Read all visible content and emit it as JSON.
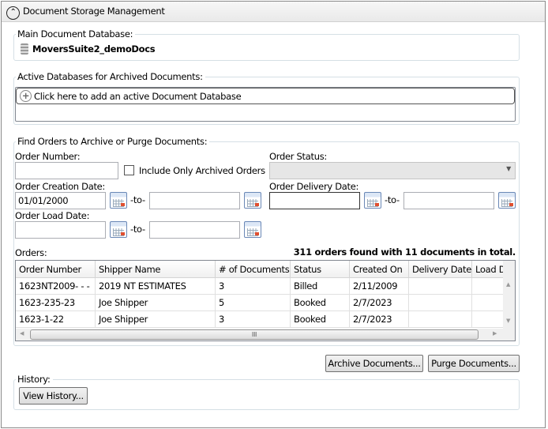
{
  "header": {
    "title": "Document Storage Management",
    "collapse_icon": "chevron-up-circle-icon"
  },
  "main_db": {
    "label": "Main Document Database:",
    "name": "MoversSuite2_demoDocs",
    "icon": "database-icon"
  },
  "active_dbs": {
    "label": "Active Databases for Archived Documents:",
    "add_text": "Click here to add an active Document Database",
    "add_icon": "plus-circle-icon"
  },
  "find": {
    "label": "Find Orders to Archive or Purge Documents:",
    "order_number_label": "Order Number:",
    "order_number_value": "",
    "archived_only_label": "Include Only Archived Orders",
    "archived_only_checked": false,
    "order_status_label": "Order Status:",
    "order_status_value": "",
    "creation_label": "Order Creation Date:",
    "creation_from": "01/01/2000",
    "creation_to": "",
    "delivery_label": "Order Delivery Date:",
    "delivery_from": "",
    "delivery_to": "",
    "load_label": "Order Load Date:",
    "load_from": "",
    "load_to": "",
    "to_label": "-to-",
    "orders_label": "Orders:",
    "summary": "311 orders found with 11 documents in total."
  },
  "grid": {
    "columns": [
      "Order Number",
      "Shipper Name",
      "# of Documents",
      "Status",
      "Created On",
      "Delivery Date",
      "Load D"
    ],
    "rows": [
      [
        "1623NT2009- - -",
        "2019 NT ESTIMATES",
        "3",
        "Billed",
        "2/11/2009",
        "",
        ""
      ],
      [
        "1623-235-23",
        "Joe Shipper",
        "5",
        "Booked",
        "2/7/2023",
        "",
        ""
      ],
      [
        "1623-1-22",
        "Joe Shipper",
        "3",
        "Booked",
        "2/7/2023",
        "",
        ""
      ]
    ]
  },
  "actions": {
    "archive": "Archive Documents...",
    "purge": "Purge Documents..."
  },
  "history": {
    "label": "History:",
    "button": "View History..."
  }
}
